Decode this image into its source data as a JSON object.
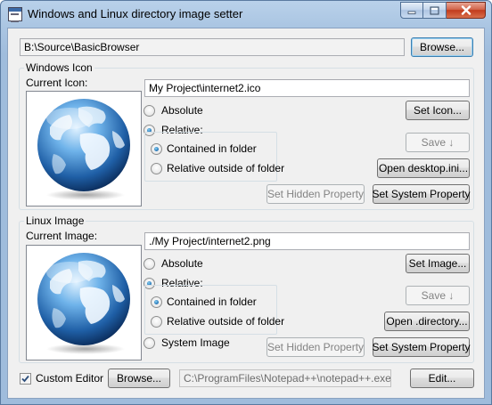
{
  "window": {
    "title": "Windows and Linux directory image setter",
    "icon": "app-window-icon"
  },
  "top": {
    "path_value": "B:\\Source\\BasicBrowser",
    "browse_label": "Browse..."
  },
  "windows_icon": {
    "group_title": "Windows Icon",
    "current_label": "Current Icon:",
    "preview_icon": "globe-icon",
    "path_value": "My Project\\internet2.ico",
    "absolute_label": "Absolute",
    "relative_label": "Relative:",
    "contained_label": "Contained in folder",
    "outside_label": "Relative outside of folder",
    "selected_mode": "Relative",
    "selected_relative": "Contained in folder",
    "set_icon_label": "Set Icon...",
    "save_label": "Save ↓",
    "open_file_label": "Open desktop.ini...",
    "set_hidden_label": "Set Hidden Property",
    "set_system_label": "Set System Property"
  },
  "linux_image": {
    "group_title": "Linux Image",
    "current_label": "Current Image:",
    "preview_icon": "globe-icon",
    "path_value": "./My Project/internet2.png",
    "absolute_label": "Absolute",
    "relative_label": "Relative:",
    "contained_label": "Contained in folder",
    "outside_label": "Relative outside of folder",
    "system_image_label": "System Image",
    "selected_mode": "Relative",
    "selected_relative": "Contained in folder",
    "set_image_label": "Set Image...",
    "save_label": "Save ↓",
    "open_file_label": "Open .directory...",
    "set_hidden_label": "Set Hidden Property",
    "set_system_label": "Set System Property"
  },
  "editor": {
    "custom_editor_label": "Custom Editor",
    "custom_editor_checked": true,
    "browse_label": "Browse...",
    "path_value": "C:\\ProgramFiles\\Notepad++\\notepad++.exe",
    "edit_label": "Edit..."
  }
}
